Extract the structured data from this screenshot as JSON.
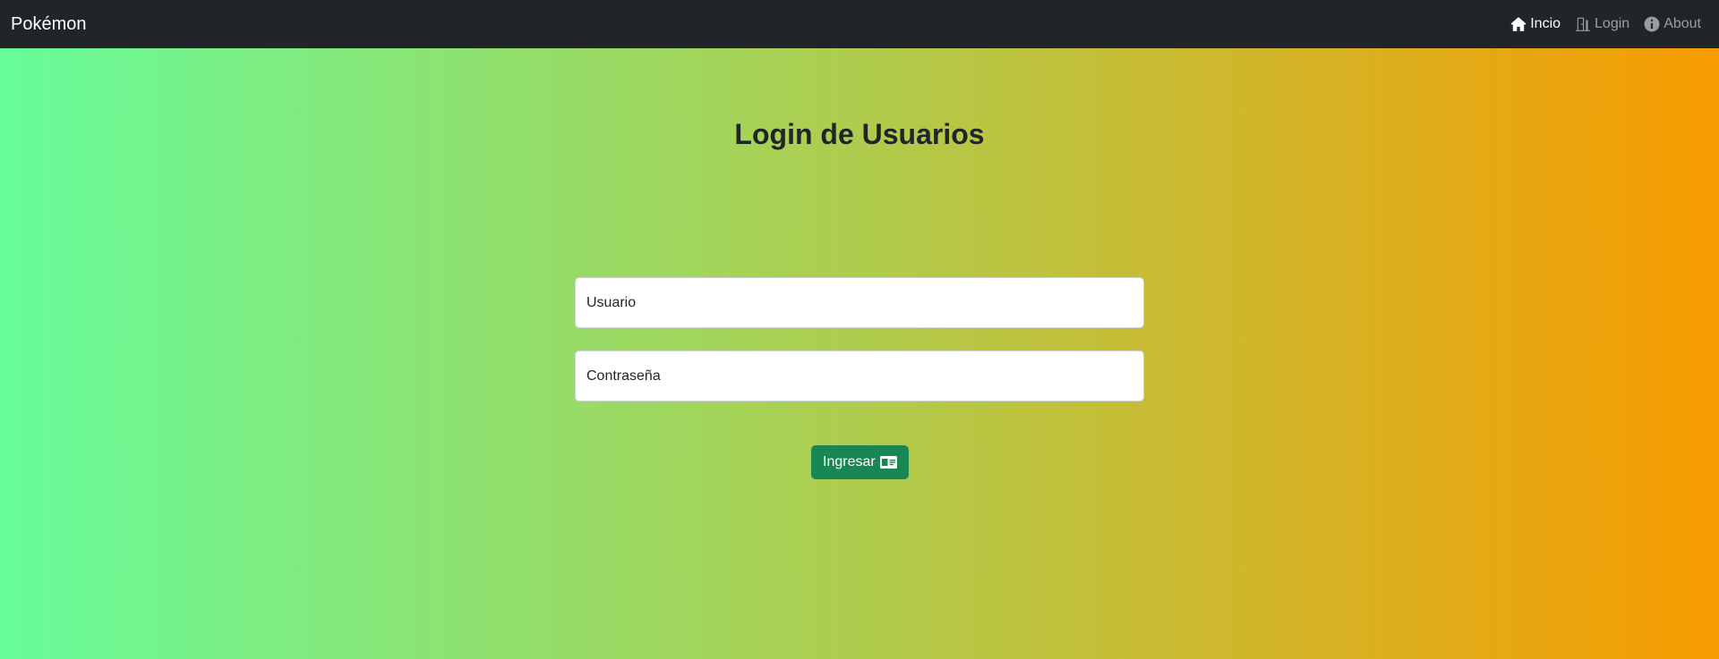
{
  "navbar": {
    "brand": "Pokémon",
    "links": [
      {
        "label": "Incio",
        "icon": "home-icon",
        "active": true
      },
      {
        "label": "Login",
        "icon": "door-icon",
        "active": false
      },
      {
        "label": "About",
        "icon": "info-circle-icon",
        "active": false
      }
    ],
    "background_color": "#212529"
  },
  "page": {
    "title": "Login de Usuarios",
    "background_gradient": [
      "#66fc9a",
      "#f89c00"
    ]
  },
  "form": {
    "username": {
      "placeholder": "Usuario",
      "value": ""
    },
    "password": {
      "placeholder": "Contraseña",
      "value": ""
    },
    "submit": {
      "label": "Ingresar",
      "icon": "id-card-icon",
      "color": "#198754"
    }
  }
}
